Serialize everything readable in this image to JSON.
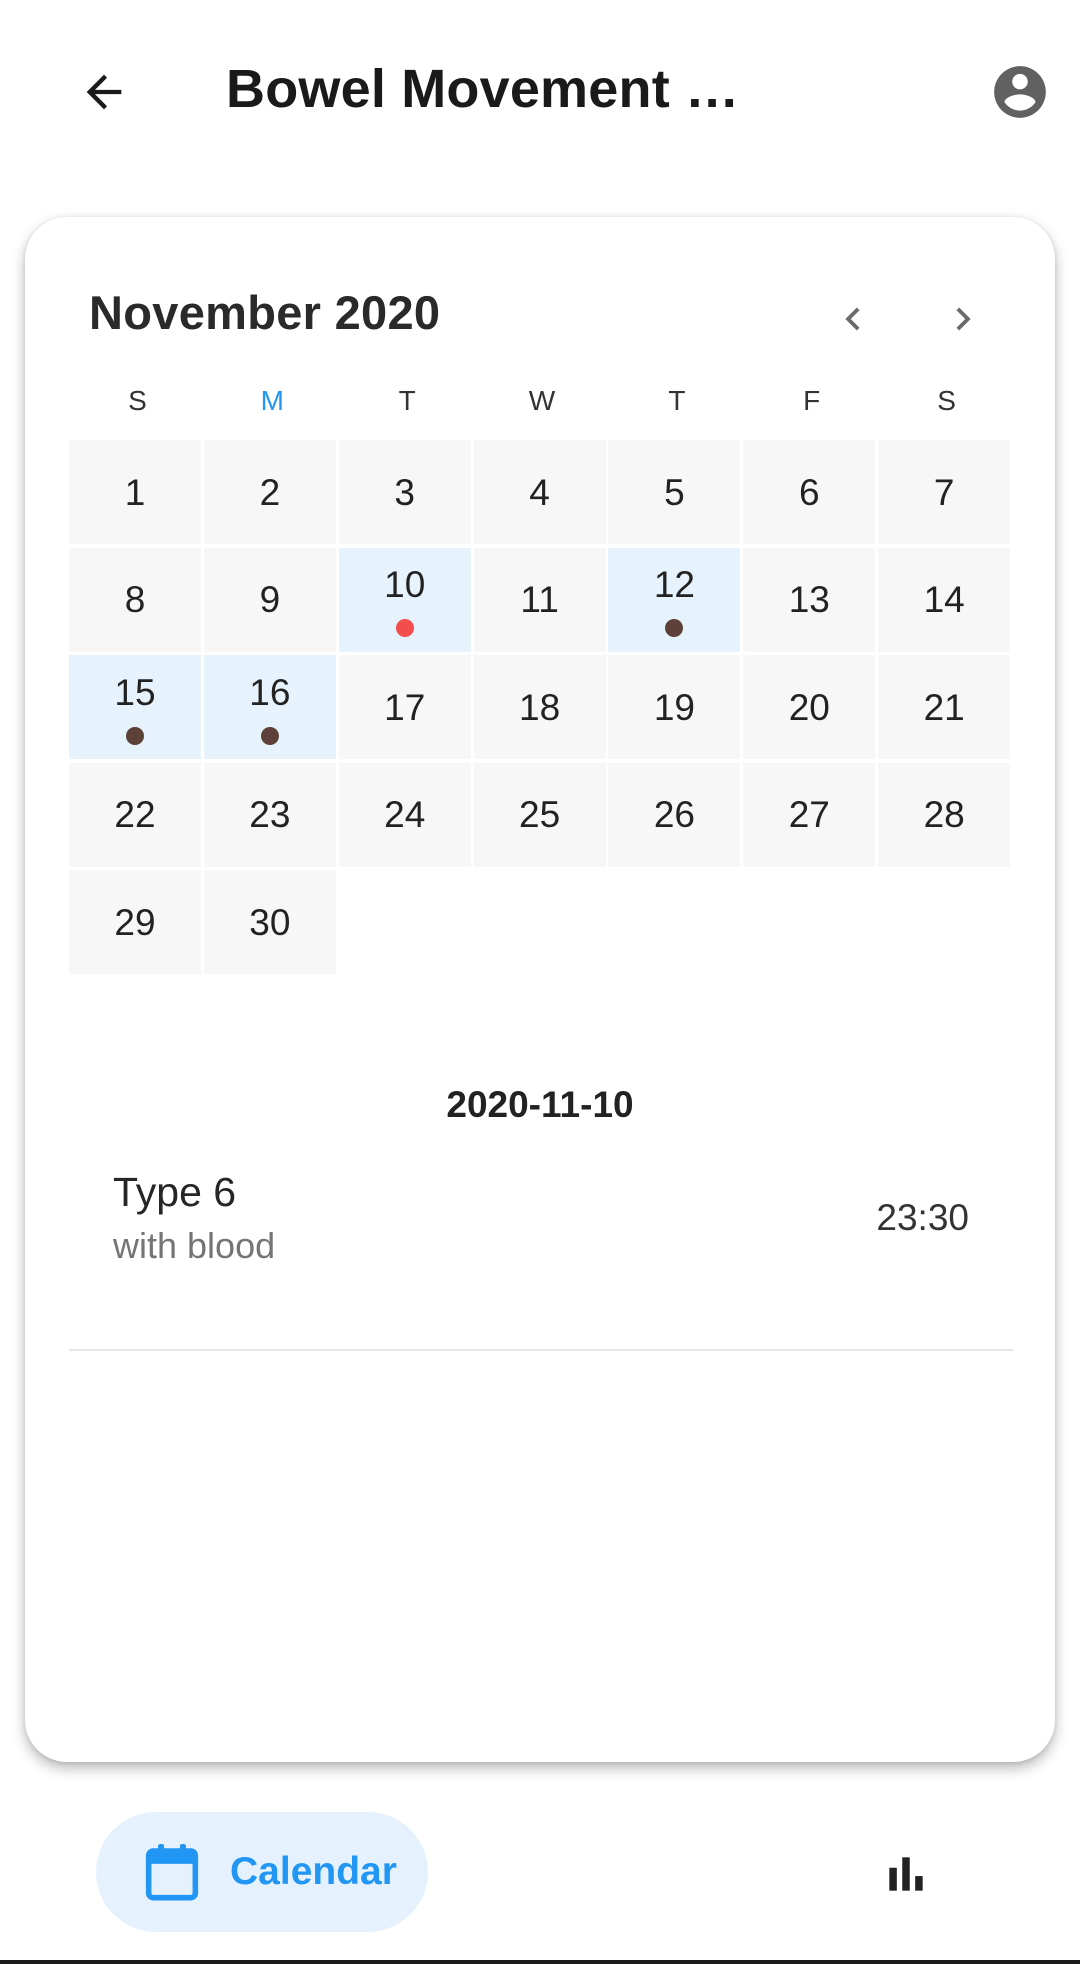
{
  "appbar": {
    "title": "Bowel Movement …",
    "back_icon": "arrow-left-icon",
    "account_icon": "account-circle-icon"
  },
  "calendar": {
    "month_label": "November 2020",
    "prev_icon": "chevron-left-icon",
    "next_icon": "chevron-right-icon",
    "weekdays": [
      "S",
      "M",
      "T",
      "W",
      "T",
      "F",
      "S"
    ],
    "current_weekday_index": 1,
    "days": [
      {
        "label": "1"
      },
      {
        "label": "2"
      },
      {
        "label": "3"
      },
      {
        "label": "4"
      },
      {
        "label": "5"
      },
      {
        "label": "6"
      },
      {
        "label": "7"
      },
      {
        "label": "8"
      },
      {
        "label": "9"
      },
      {
        "label": "10",
        "dot": "#f44d4d"
      },
      {
        "label": "11"
      },
      {
        "label": "12",
        "dot": "#5d4037"
      },
      {
        "label": "13"
      },
      {
        "label": "14"
      },
      {
        "label": "15",
        "dot": "#5d4037"
      },
      {
        "label": "16",
        "dot": "#5d4037"
      },
      {
        "label": "17"
      },
      {
        "label": "18"
      },
      {
        "label": "19"
      },
      {
        "label": "20"
      },
      {
        "label": "21"
      },
      {
        "label": "22"
      },
      {
        "label": "23"
      },
      {
        "label": "24"
      },
      {
        "label": "25"
      },
      {
        "label": "26"
      },
      {
        "label": "27"
      },
      {
        "label": "28"
      },
      {
        "label": "29"
      },
      {
        "label": "30"
      }
    ]
  },
  "selected": {
    "date": "2020-11-10",
    "entries": [
      {
        "type": "Type 6",
        "detail": "with blood",
        "time": "23:30"
      }
    ]
  },
  "bottom_nav": {
    "calendar_label": "Calendar",
    "calendar_icon": "calendar-icon",
    "stats_icon": "bar-chart-icon"
  },
  "colors": {
    "accent": "#2196f3",
    "entry_day_bg": "#e6f3fd",
    "blood_dot": "#f44d4d",
    "normal_dot": "#5d4037"
  }
}
